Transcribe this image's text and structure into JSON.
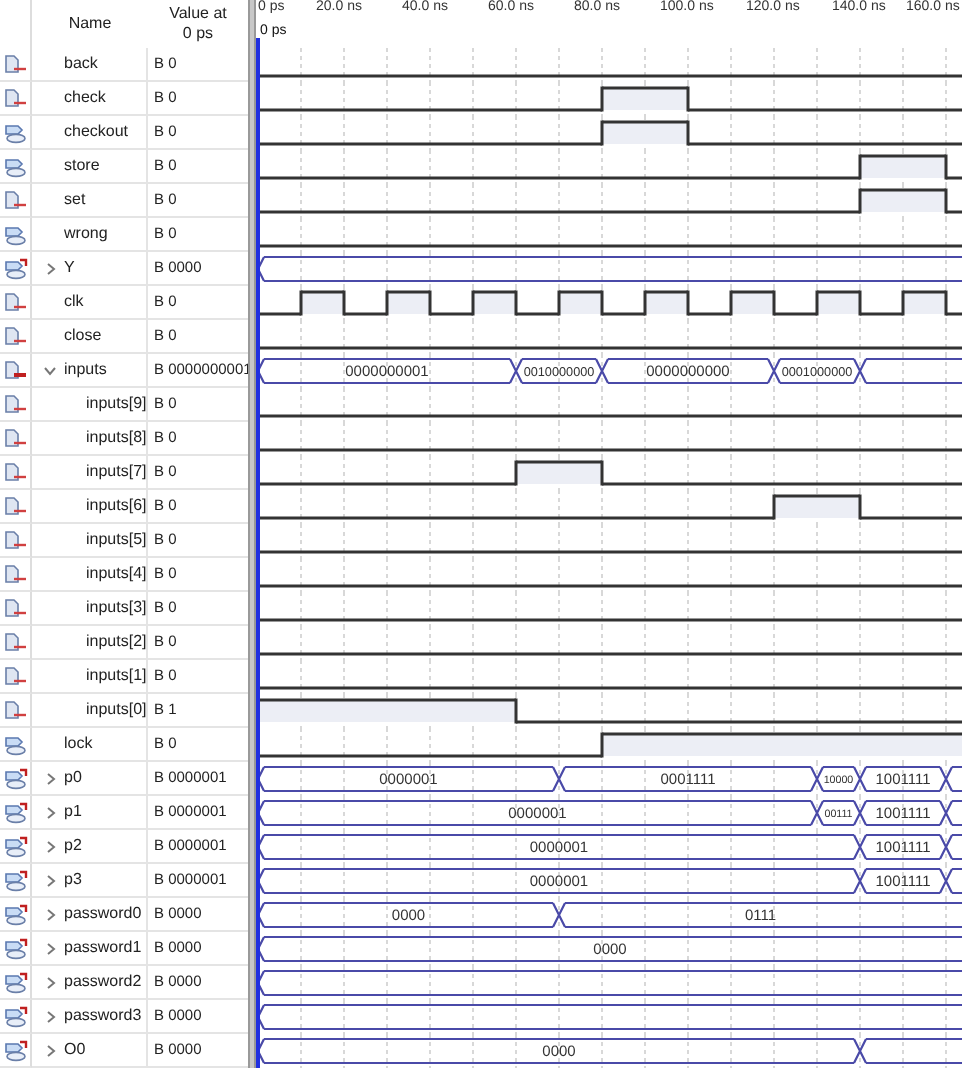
{
  "header": {
    "name": "Name",
    "value": "Value at\n0 ps"
  },
  "ruler": {
    "ticks": [
      "0 ps",
      "20.0 ns",
      "40.0 ns",
      "60.0 ns",
      "80.0 ns",
      "100.0 ns",
      "120.0 ns",
      "140.0 ns",
      "160.0 ns"
    ]
  },
  "cursor": {
    "label": "0 ps"
  },
  "signals": [
    {
      "name": "back",
      "value": "B 0",
      "kind": "input",
      "high": [
        false,
        false,
        false,
        false,
        false,
        false,
        false,
        false,
        false,
        false,
        false,
        false,
        false,
        false,
        false,
        false,
        false
      ]
    },
    {
      "name": "check",
      "value": "B 0",
      "kind": "input",
      "high": [
        false,
        false,
        false,
        false,
        false,
        false,
        false,
        false,
        true,
        true,
        false,
        false,
        false,
        false,
        false,
        false,
        false
      ]
    },
    {
      "name": "checkout",
      "value": "B 0",
      "kind": "output",
      "high": [
        false,
        false,
        false,
        false,
        false,
        false,
        false,
        false,
        true,
        true,
        false,
        false,
        false,
        false,
        false,
        false,
        false
      ]
    },
    {
      "name": "store",
      "value": "B 0",
      "kind": "output",
      "high": [
        false,
        false,
        false,
        false,
        false,
        false,
        false,
        false,
        false,
        false,
        false,
        false,
        false,
        false,
        true,
        true,
        false
      ]
    },
    {
      "name": "set",
      "value": "B 0",
      "kind": "input",
      "high": [
        false,
        false,
        false,
        false,
        false,
        false,
        false,
        false,
        false,
        false,
        false,
        false,
        false,
        false,
        true,
        true,
        false
      ]
    },
    {
      "name": "wrong",
      "value": "B 0",
      "kind": "output",
      "high": [
        false,
        false,
        false,
        false,
        false,
        false,
        false,
        false,
        false,
        false,
        false,
        false,
        false,
        false,
        false,
        false,
        false
      ]
    },
    {
      "name": "Y",
      "value": "B 0000",
      "kind": "output",
      "expanded": false,
      "edges": [
        true,
        false,
        false,
        false,
        false,
        false,
        false,
        false,
        false,
        false,
        false,
        false,
        false,
        false,
        false,
        false,
        false
      ]
    },
    {
      "name": "clk",
      "value": "B 0",
      "kind": "input",
      "high": [
        false,
        true,
        false,
        true,
        false,
        true,
        false,
        true,
        false,
        true,
        false,
        true,
        false,
        true,
        false,
        true,
        false
      ]
    },
    {
      "name": "close",
      "value": "B 0",
      "kind": "input",
      "high": [
        false,
        false,
        false,
        false,
        false,
        false,
        false,
        false,
        false,
        false,
        false,
        false,
        false,
        false,
        false,
        false,
        false
      ]
    },
    {
      "name": "inputs",
      "value": "B 0000000001",
      "kind": "input",
      "expanded": true,
      "edges": [
        true,
        false,
        false,
        false,
        false,
        false,
        true,
        false,
        true,
        false,
        false,
        false,
        true,
        false,
        true,
        false,
        false
      ],
      "labels": [
        "0000000001",
        "0010000000",
        "0000000000",
        "0001000000"
      ],
      "children": [
        {
          "name": "inputs[9]",
          "value": "B 0",
          "kind": "input",
          "high": [
            false,
            false,
            false,
            false,
            false,
            false,
            false,
            false,
            false,
            false,
            false,
            false,
            false,
            false,
            false,
            false,
            false
          ]
        },
        {
          "name": "inputs[8]",
          "value": "B 0",
          "kind": "input",
          "high": [
            false,
            false,
            false,
            false,
            false,
            false,
            false,
            false,
            false,
            false,
            false,
            false,
            false,
            false,
            false,
            false,
            false
          ]
        },
        {
          "name": "inputs[7]",
          "value": "B 0",
          "kind": "input",
          "high": [
            false,
            false,
            false,
            false,
            false,
            false,
            true,
            true,
            false,
            false,
            false,
            false,
            false,
            false,
            false,
            false,
            false
          ]
        },
        {
          "name": "inputs[6]",
          "value": "B 0",
          "kind": "input",
          "high": [
            false,
            false,
            false,
            false,
            false,
            false,
            false,
            false,
            false,
            false,
            false,
            false,
            true,
            true,
            false,
            false,
            false
          ]
        },
        {
          "name": "inputs[5]",
          "value": "B 0",
          "kind": "input",
          "high": [
            false,
            false,
            false,
            false,
            false,
            false,
            false,
            false,
            false,
            false,
            false,
            false,
            false,
            false,
            false,
            false,
            false
          ]
        },
        {
          "name": "inputs[4]",
          "value": "B 0",
          "kind": "input",
          "high": [
            false,
            false,
            false,
            false,
            false,
            false,
            false,
            false,
            false,
            false,
            false,
            false,
            false,
            false,
            false,
            false,
            false
          ]
        },
        {
          "name": "inputs[3]",
          "value": "B 0",
          "kind": "input",
          "high": [
            false,
            false,
            false,
            false,
            false,
            false,
            false,
            false,
            false,
            false,
            false,
            false,
            false,
            false,
            false,
            false,
            false
          ]
        },
        {
          "name": "inputs[2]",
          "value": "B 0",
          "kind": "input",
          "high": [
            false,
            false,
            false,
            false,
            false,
            false,
            false,
            false,
            false,
            false,
            false,
            false,
            false,
            false,
            false,
            false,
            false
          ]
        },
        {
          "name": "inputs[1]",
          "value": "B 0",
          "kind": "input",
          "high": [
            false,
            false,
            false,
            false,
            false,
            false,
            false,
            false,
            false,
            false,
            false,
            false,
            false,
            false,
            false,
            false,
            false
          ]
        },
        {
          "name": "inputs[0]",
          "value": "B 1",
          "kind": "input",
          "high": [
            true,
            true,
            true,
            true,
            true,
            true,
            false,
            false,
            false,
            false,
            false,
            false,
            false,
            false,
            false,
            false,
            false
          ]
        }
      ]
    },
    {
      "name": "lock",
      "value": "B 0",
      "kind": "output",
      "high": [
        false,
        false,
        false,
        false,
        false,
        false,
        false,
        false,
        true,
        true,
        true,
        true,
        true,
        true,
        true,
        true,
        true
      ]
    },
    {
      "name": "p0",
      "value": "B 0000001",
      "kind": "output",
      "expanded": false,
      "edges": [
        true,
        false,
        false,
        false,
        false,
        false,
        false,
        true,
        false,
        false,
        false,
        false,
        false,
        true,
        true,
        false,
        true
      ],
      "labels": [
        "0000001",
        "0001111",
        "10000",
        "1001111"
      ]
    },
    {
      "name": "p1",
      "value": "B 0000001",
      "kind": "output",
      "expanded": false,
      "edges": [
        true,
        false,
        false,
        false,
        false,
        false,
        false,
        false,
        false,
        false,
        false,
        false,
        false,
        true,
        true,
        false,
        true
      ],
      "labels": [
        "0000001",
        "00111",
        "1001111"
      ]
    },
    {
      "name": "p2",
      "value": "B 0000001",
      "kind": "output",
      "expanded": false,
      "edges": [
        true,
        false,
        false,
        false,
        false,
        false,
        false,
        false,
        false,
        false,
        false,
        false,
        false,
        false,
        true,
        false,
        true
      ],
      "labels": [
        "0000001",
        "1001111"
      ]
    },
    {
      "name": "p3",
      "value": "B 0000001",
      "kind": "output",
      "expanded": false,
      "edges": [
        true,
        false,
        false,
        false,
        false,
        false,
        false,
        false,
        false,
        false,
        false,
        false,
        false,
        false,
        true,
        false,
        true
      ],
      "labels": [
        "0000001",
        "1001111"
      ]
    },
    {
      "name": "password0",
      "value": "B 0000",
      "kind": "output",
      "expanded": false,
      "edges": [
        true,
        false,
        false,
        false,
        false,
        false,
        false,
        true,
        false,
        false,
        false,
        false,
        false,
        false,
        false,
        false,
        false
      ],
      "labels": [
        "0000",
        "0111"
      ]
    },
    {
      "name": "password1",
      "value": "B 0000",
      "kind": "output",
      "expanded": false,
      "edges": [
        true,
        false,
        false,
        false,
        false,
        false,
        false,
        false,
        false,
        false,
        false,
        false,
        false,
        false,
        false,
        false,
        false
      ],
      "labels": [
        "0000"
      ]
    },
    {
      "name": "password2",
      "value": "B 0000",
      "kind": "output",
      "expanded": false,
      "edges": [
        true,
        false,
        false,
        false,
        false,
        false,
        false,
        false,
        false,
        false,
        false,
        false,
        false,
        false,
        false,
        false,
        false
      ]
    },
    {
      "name": "password3",
      "value": "B 0000",
      "kind": "output",
      "expanded": false,
      "edges": [
        true,
        false,
        false,
        false,
        false,
        false,
        false,
        false,
        false,
        false,
        false,
        false,
        false,
        false,
        false,
        false,
        false
      ]
    },
    {
      "name": "O0",
      "value": "B 0000",
      "kind": "output",
      "expanded": false,
      "edges": [
        true,
        false,
        false,
        false,
        false,
        false,
        false,
        false,
        false,
        false,
        false,
        false,
        false,
        false,
        true,
        false,
        false
      ],
      "labels": [
        "0000"
      ]
    }
  ]
}
